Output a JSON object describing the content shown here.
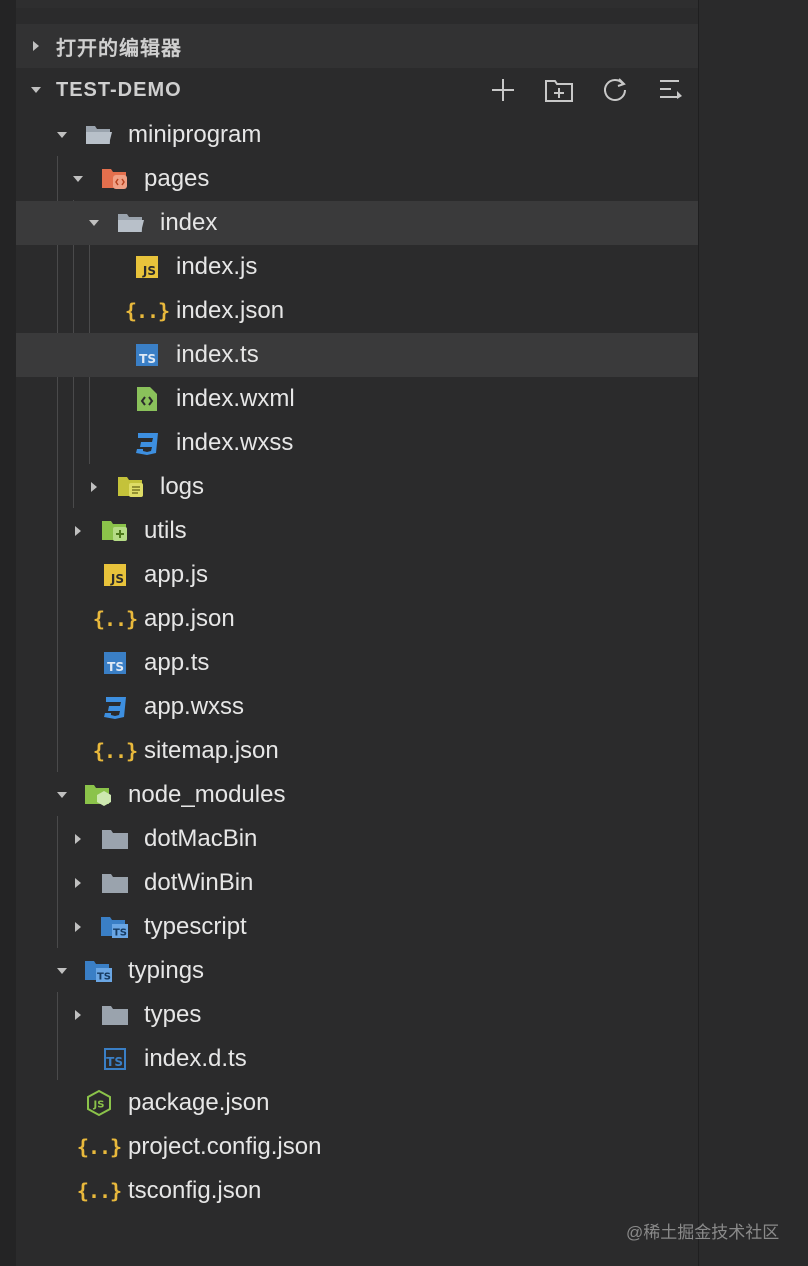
{
  "top_strip_text": "—— ——",
  "open_editors": {
    "title": "打开的编辑器"
  },
  "project": {
    "title": "TEST-DEMO",
    "actions": [
      {
        "name": "new-file-icon"
      },
      {
        "name": "new-folder-icon"
      },
      {
        "name": "refresh-icon"
      },
      {
        "name": "collapse-all-icon"
      }
    ]
  },
  "tree": [
    {
      "label": "miniprogram",
      "icon": "folder-open-icon"
    },
    {
      "label": "pages",
      "icon": "pages-folder-icon"
    },
    {
      "label": "index",
      "icon": "folder-open-icon"
    },
    {
      "label": "index.js",
      "icon": "javascript-file-icon"
    },
    {
      "label": "index.json",
      "icon": "json-file-icon"
    },
    {
      "label": "index.ts",
      "icon": "typescript-file-icon"
    },
    {
      "label": "index.wxml",
      "icon": "wxml-file-icon"
    },
    {
      "label": "index.wxss",
      "icon": "css-file-icon"
    },
    {
      "label": "logs",
      "icon": "logs-folder-icon"
    },
    {
      "label": "utils",
      "icon": "utils-folder-icon"
    },
    {
      "label": "app.js",
      "icon": "javascript-file-icon"
    },
    {
      "label": "app.json",
      "icon": "json-file-icon"
    },
    {
      "label": "app.ts",
      "icon": "typescript-file-icon"
    },
    {
      "label": "app.wxss",
      "icon": "css-file-icon"
    },
    {
      "label": "sitemap.json",
      "icon": "json-file-icon"
    },
    {
      "label": "node_modules",
      "icon": "node-modules-folder-icon"
    },
    {
      "label": "dotMacBin",
      "icon": "folder-icon"
    },
    {
      "label": "dotWinBin",
      "icon": "folder-icon"
    },
    {
      "label": "typescript",
      "icon": "typescript-folder-icon"
    },
    {
      "label": "typings",
      "icon": "typings-folder-icon"
    },
    {
      "label": "types",
      "icon": "folder-icon"
    },
    {
      "label": "index.d.ts",
      "icon": "typescript-definition-file-icon"
    },
    {
      "label": "package.json",
      "icon": "nodejs-file-icon"
    },
    {
      "label": "project.config.json",
      "icon": "json-file-icon"
    },
    {
      "label": "tsconfig.json",
      "icon": "json-file-icon"
    }
  ],
  "icon_glyphs": {
    "js": "JS",
    "ts": "TS",
    "json": "{..}"
  },
  "watermark": "@稀土掘金技术社区",
  "colors": {
    "background": "#2b2b2c",
    "selected_row": "#3a3a3b",
    "json_icon": "#e9b93c",
    "js_icon": "#e8c33b",
    "ts_icon": "#3a7fc6",
    "css_icon": "#3d8fe0",
    "wxml_icon": "#8ac15b",
    "pages_folder": "#e36f4d",
    "green_folder": "#8bc34a",
    "grey_folder": "#9aa3ad"
  }
}
